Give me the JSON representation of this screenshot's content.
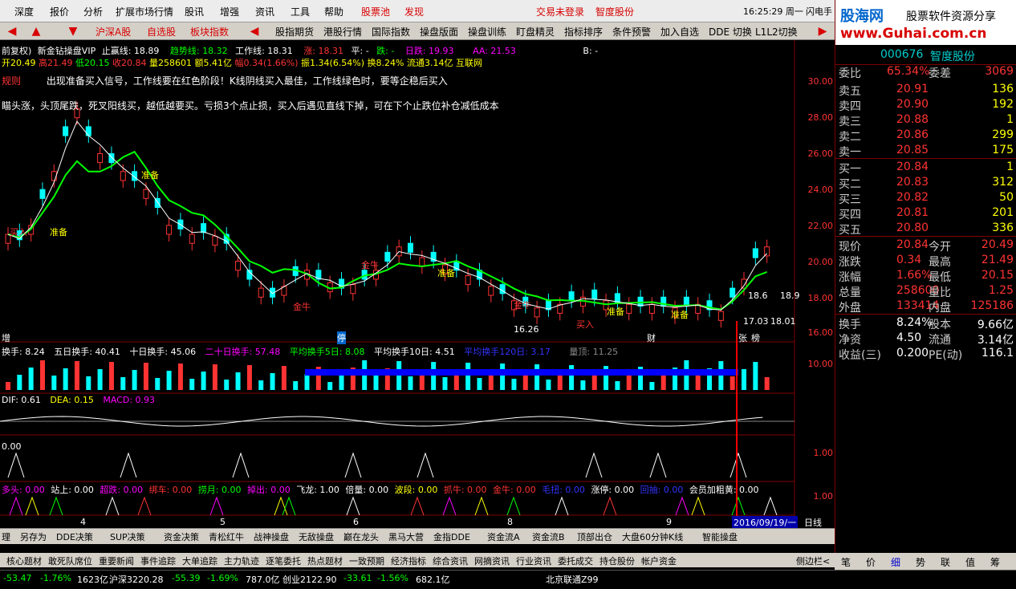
{
  "menu": {
    "items": [
      "深度",
      "报价",
      "分析",
      "扩展市场行情",
      "股讯",
      "增强",
      "资讯",
      "工具",
      "帮助"
    ],
    "stock_pool": "股票池",
    "discover": "发现",
    "not_logged": "交易未登录",
    "stock_name_red": "智度股份",
    "time": "16:25:29 周一",
    "flash": "闪电手"
  },
  "toolbar": {
    "buttons": [
      "沪深A股",
      "自选股",
      "板块指数",
      "股指期货",
      "港股行情",
      "国际指数",
      "操盘版面",
      "操盘训练",
      "盯盘精灵",
      "指标排序",
      "条件预警",
      "加入自选",
      "DDE 切换",
      "L1L2切换"
    ]
  },
  "chart_info": {
    "line1": {
      "fq": "前复权)",
      "name": "新金钻操盘VIP",
      "stop": "止赢线: 18.89",
      "trend": "趋势线: 18.32",
      "work": "工作线: 18.31",
      "zhang": "涨: 18.31",
      "ping": "平: -",
      "die": "跌: -",
      "rixian": "日跌: 19.93",
      "aa": "AA: 21.53",
      "b": "B: -"
    },
    "line2": {
      "open": "开20.49",
      "high": "高21.49",
      "low": "低20.15",
      "close": "收20.84",
      "vol": "量258601",
      "amt": "额5.41亿",
      "chg": "幅0.34(1.66%)",
      "ratio": "振1.34(6.54%)",
      "turn": "换8.24%",
      "float": "流通3.14亿",
      "sector": "互联网"
    },
    "rule_label": "规则",
    "rule1": "出现准备买入信号，工作线要在红色阶段！K线阴线买入最佳，工作线绿色时，要等企稳后买入",
    "rule2": "瞄头涨，头顶尾跌，死叉阳线买，越低越要买。亏损3个点止损，买入后遇见直线下掉，可在下个止跌位补仓减低成本",
    "y_labels": [
      "30.00",
      "28.00",
      "26.00",
      "24.00",
      "22.00",
      "20.00",
      "18.00",
      "16.00"
    ],
    "annotations": [
      "买入",
      "准备",
      "准备",
      "金牛",
      "金牛",
      "金牛",
      "准备",
      "买入",
      "准备",
      "准备",
      "16.26",
      "买入",
      "18.6",
      "18.9",
      "17.03",
      "18.01",
      "增",
      "停",
      "财",
      "张",
      "榜"
    ],
    "turnover": {
      "t1": "换手: 8.24",
      "t5": "五日换手: 40.41",
      "t10": "十日换手: 45.06",
      "t20": "二十日换手: 57.48",
      "avg5": "平均换手5日: 8.08",
      "avg10": "平均换手10日: 4.51",
      "avg120": "平均换手120日: 3.17",
      "liang": "量顶: 11.25",
      "ylab": "10.00"
    },
    "macd": {
      "dif": "DIF: 0.61",
      "dea": "DEA: 0.15",
      "macd": "MACD: 0.93"
    },
    "ind3": {
      "v": "0.00",
      "ylab": "1.00"
    },
    "ind4": {
      "items": [
        "多头: 0.00",
        "站上: 0.00",
        "超跌: 0.00",
        "绑车: 0.00",
        "捞月: 0.00",
        "掉出: 0.00",
        "飞龙: 1.00",
        "倍量: 0.00",
        "波段: 0.00",
        "抓牛: 0.00",
        "金牛: 0.00",
        "毛扭: 0.00",
        "涨停: 0.00",
        "回抽: 0.00",
        "会员加粗黄: 0.00"
      ],
      "ylab": "1.00"
    },
    "date_labels": [
      "4",
      "5",
      "6",
      "8",
      "9"
    ],
    "cursor_date": "2016/09/19/一",
    "period": "日线"
  },
  "quote": {
    "code": "000676",
    "name": "智度股份",
    "weibi_label": "委比",
    "weibi": "65.34%",
    "weicha_label": "委差",
    "weicha": "3069",
    "asks": [
      {
        "l": "卖五",
        "p": "20.91",
        "v": "136"
      },
      {
        "l": "卖四",
        "p": "20.90",
        "v": "192"
      },
      {
        "l": "卖三",
        "p": "20.88",
        "v": "1"
      },
      {
        "l": "卖二",
        "p": "20.86",
        "v": "299"
      },
      {
        "l": "卖一",
        "p": "20.85",
        "v": "175"
      }
    ],
    "bids": [
      {
        "l": "买一",
        "p": "20.84",
        "v": "1"
      },
      {
        "l": "买二",
        "p": "20.83",
        "v": "312"
      },
      {
        "l": "买三",
        "p": "20.82",
        "v": "50"
      },
      {
        "l": "买四",
        "p": "20.81",
        "v": "201"
      },
      {
        "l": "买五",
        "p": "20.80",
        "v": "336"
      }
    ],
    "stats": [
      {
        "a": "现价",
        "av": "20.84",
        "b": "今开",
        "bv": "20.49"
      },
      {
        "a": "涨跌",
        "av": "0.34",
        "b": "最高",
        "bv": "21.49"
      },
      {
        "a": "涨幅",
        "av": "1.66%",
        "b": "最低",
        "bv": "20.15"
      },
      {
        "a": "总量",
        "av": "258600",
        "b": "量比",
        "bv": "1.25"
      },
      {
        "a": "外盘",
        "av": "133414",
        "b": "内盘",
        "bv": "125186"
      }
    ],
    "stats2": [
      {
        "a": "换手",
        "av": "8.24%",
        "b": "股本",
        "bv": "9.66亿"
      },
      {
        "a": "净资",
        "av": "4.50",
        "b": "流通",
        "bv": "3.14亿"
      },
      {
        "a": "收益(三)",
        "av": "0.200",
        "b": "PE(动)",
        "bv": "116.1"
      }
    ],
    "tabs": [
      "笔",
      "价",
      "细",
      "势",
      "联",
      "值",
      "筹"
    ],
    "side_label": "侧边栏<"
  },
  "logo": {
    "title": "股海网",
    "subtitle": "股票软件资源分享",
    "url": "www.Guhai.com.cn"
  },
  "bottom_tabs": [
    "理",
    "另存为",
    "DDE决策",
    "SUP决策",
    "资金决策",
    "青松红牛",
    "战神操盘",
    "无敌操盘",
    "巅在龙头",
    "黑马大营",
    "金指DDE",
    "资金流A",
    "资金流B",
    "顶部出仓",
    "大盘60分钟K线",
    "智能操盘"
  ],
  "bottom_tabs2": [
    "核心题材",
    "敢死队席位",
    "重要新闻",
    "事件追踪",
    "大单追踪",
    "主力轨迹",
    "逐笔委托",
    "热点题材",
    "一致预期",
    "经济指标",
    "综合资讯",
    "网摘资讯",
    "行业资讯",
    "委托成交",
    "持仓股份",
    "帐户资金"
  ],
  "status": {
    "s1": "-53.47",
    "s2": "-1.76%",
    "s3": "1623亿",
    "sh": "沪深3220.28",
    "sh2": "-55.39",
    "sh3": "-1.69%",
    "sh4": "787.0亿",
    "cy": "创业2122.90",
    "cy2": "-33.61",
    "cy3": "-1.56%",
    "cy4": "682.1亿",
    "net": "北京联通Z99"
  }
}
